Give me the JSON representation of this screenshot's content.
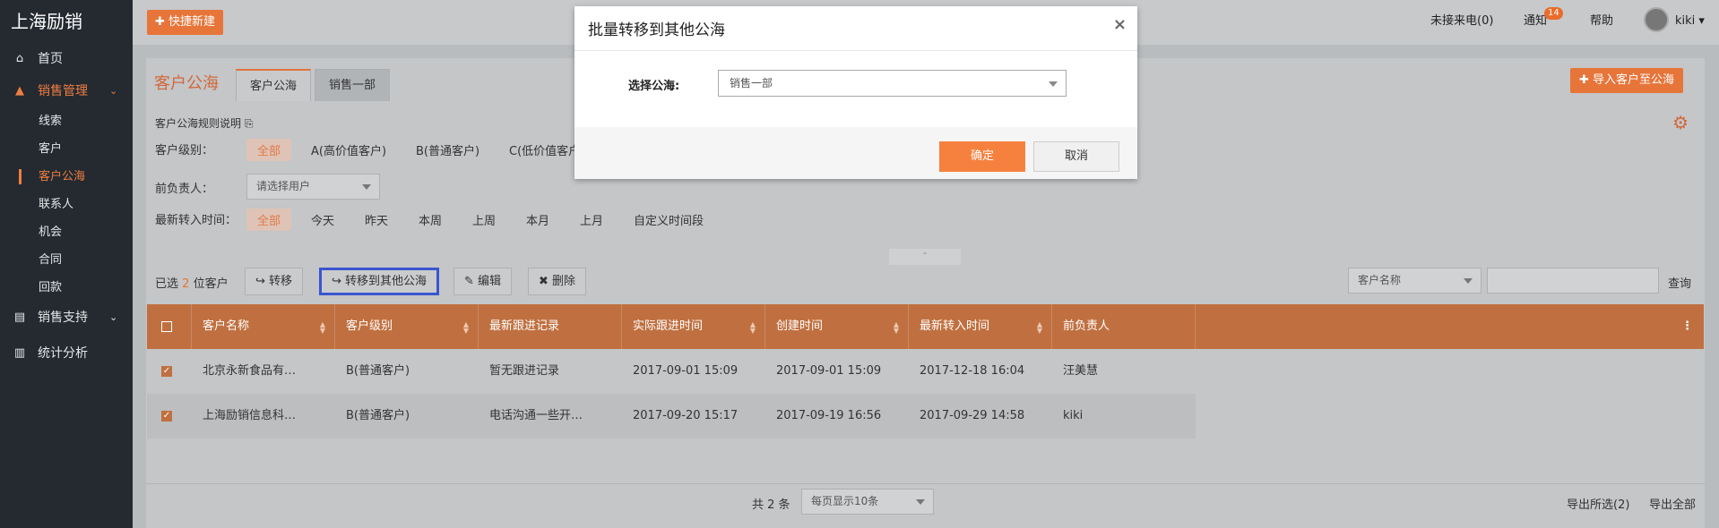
{
  "app": {
    "brand": "上海励销"
  },
  "sidebar": {
    "items": [
      {
        "label": "首页",
        "icon": "home-icon"
      },
      {
        "label": "销售管理",
        "icon": "chart-area-icon",
        "active": true
      },
      {
        "label": "销售支持",
        "icon": "document-icon"
      },
      {
        "label": "统计分析",
        "icon": "bar-chart-icon"
      }
    ],
    "sub_items": [
      "线索",
      "客户",
      "客户公海",
      "联系人",
      "机会",
      "合同",
      "回款"
    ],
    "active_sub": "客户公海"
  },
  "topbar": {
    "quick_new": "✚ 快捷新建",
    "missed_calls": "未接来电(0)",
    "notify": "通知",
    "notify_count": "14",
    "help": "帮助",
    "user": "kiki ▾"
  },
  "page": {
    "title": "客户公海",
    "tabs": [
      "客户公海",
      "销售一部"
    ],
    "import_btn": "✚ 导入客户至公海",
    "rules_link": "客户公海规则说明 ⎘",
    "level_label": "客户级别：",
    "level_options": [
      "全部",
      "A(高价值客户)",
      "B(普通客户)",
      "C(低价值客户)"
    ],
    "owner_label": "前负责人：",
    "owner_placeholder": "请选择用户",
    "time_label": "最新转入时间：",
    "time_options": [
      "全部",
      "今天",
      "昨天",
      "本周",
      "上周",
      "本月",
      "上月",
      "自定义时间段"
    ]
  },
  "toolbar": {
    "selected_prefix": "已选",
    "selected_count": "2",
    "selected_suffix": "位客户",
    "transfer": "↪ 转移",
    "transfer_other": "↪ 转移到其他公海",
    "edit": "✎ 编辑",
    "delete": "✖ 删除",
    "search_field": "客户名称",
    "search_value": "",
    "query": "查询"
  },
  "table": {
    "headers": [
      "客户名称",
      "客户级别",
      "最新跟进记录",
      "实际跟进时间",
      "创建时间",
      "最新转入时间",
      "前负责人"
    ],
    "rows": [
      [
        "北京永新食品有…",
        "B(普通客户)",
        "暂无跟进记录",
        "2017-09-01 15:09",
        "2017-09-01 15:09",
        "2017-12-18 16:04",
        "汪美慧"
      ],
      [
        "上海励销信息科…",
        "B(普通客户)",
        "电话沟通一些开…",
        "2017-09-20 15:17",
        "2017-09-19 16:56",
        "2017-09-29 14:58",
        "kiki"
      ]
    ],
    "checked": [
      true,
      true
    ]
  },
  "pager": {
    "total": "共 2 条",
    "page_size": "每页显示10条",
    "export_selected": "导出所选(2)",
    "export_all": "导出全部"
  },
  "modal": {
    "title": "批量转移到其他公海",
    "close": "×",
    "field_label": "选择公海:",
    "field_value": "销售一部",
    "ok": "确定",
    "cancel": "取消"
  },
  "colors": {
    "accent": "#e7753a",
    "highlight_border": "#3a55d0"
  }
}
